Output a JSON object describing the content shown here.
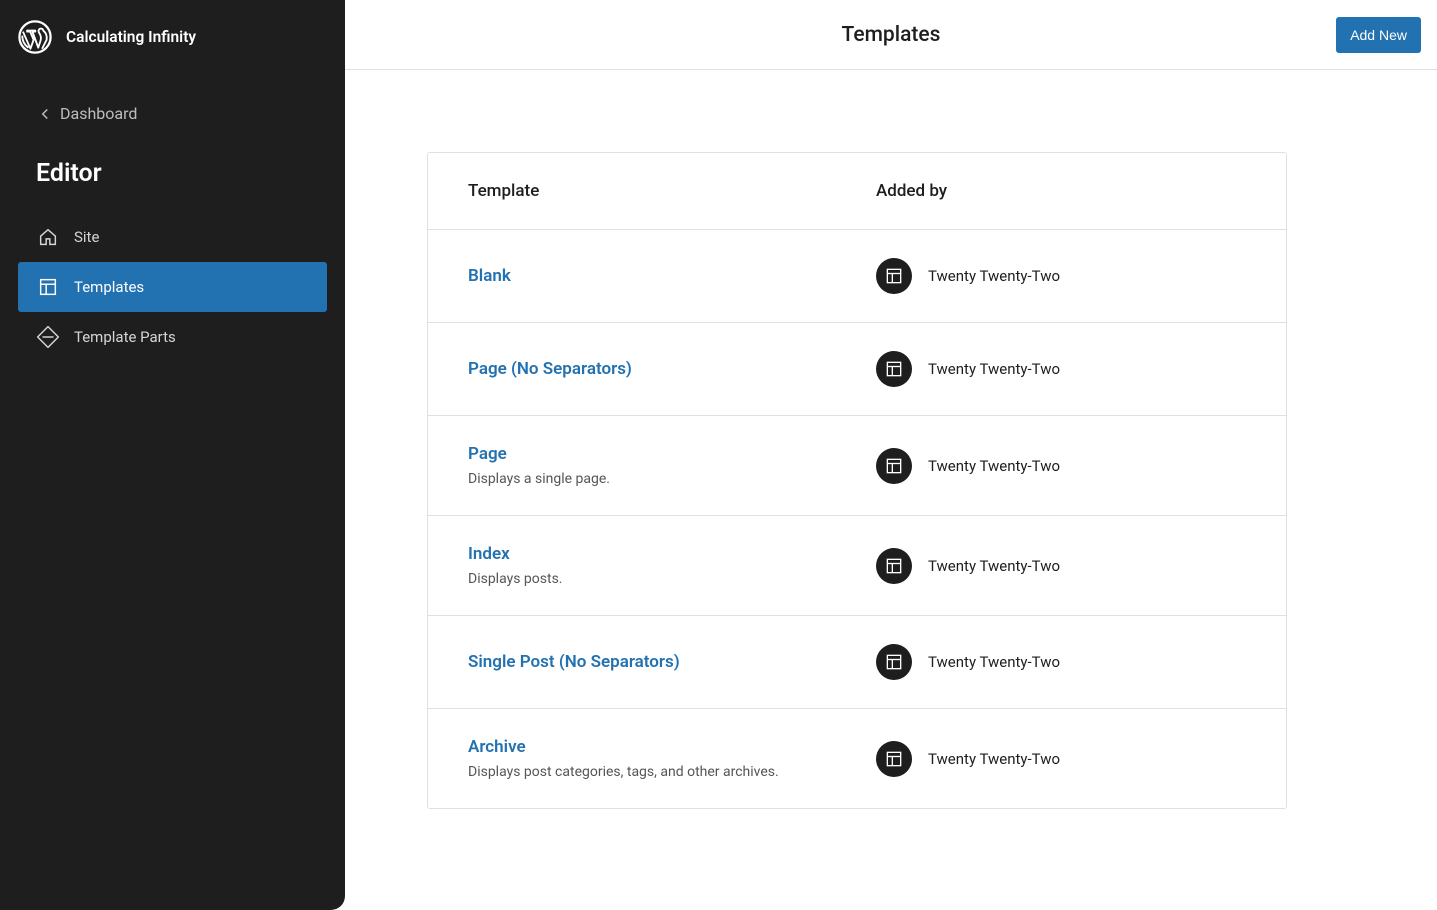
{
  "sidebar": {
    "site_title": "Calculating Infinity",
    "back_label": "Dashboard",
    "section_heading": "Editor",
    "nav": {
      "site": "Site",
      "templates": "Templates",
      "template_parts": "Template Parts"
    }
  },
  "header": {
    "title": "Templates",
    "add_new_label": "Add New"
  },
  "table": {
    "col_template": "Template",
    "col_added_by": "Added by",
    "rows": [
      {
        "name": "Blank",
        "description": "",
        "added_by": "Twenty Twenty-Two"
      },
      {
        "name": "Page (No Separators)",
        "description": "",
        "added_by": "Twenty Twenty-Two"
      },
      {
        "name": "Page",
        "description": "Displays a single page.",
        "added_by": "Twenty Twenty-Two"
      },
      {
        "name": "Index",
        "description": "Displays posts.",
        "added_by": "Twenty Twenty-Two"
      },
      {
        "name": "Single Post (No Separators)",
        "description": "",
        "added_by": "Twenty Twenty-Two"
      },
      {
        "name": "Archive",
        "description": "Displays post categories, tags, and other archives.",
        "added_by": "Twenty Twenty-Two"
      }
    ]
  }
}
